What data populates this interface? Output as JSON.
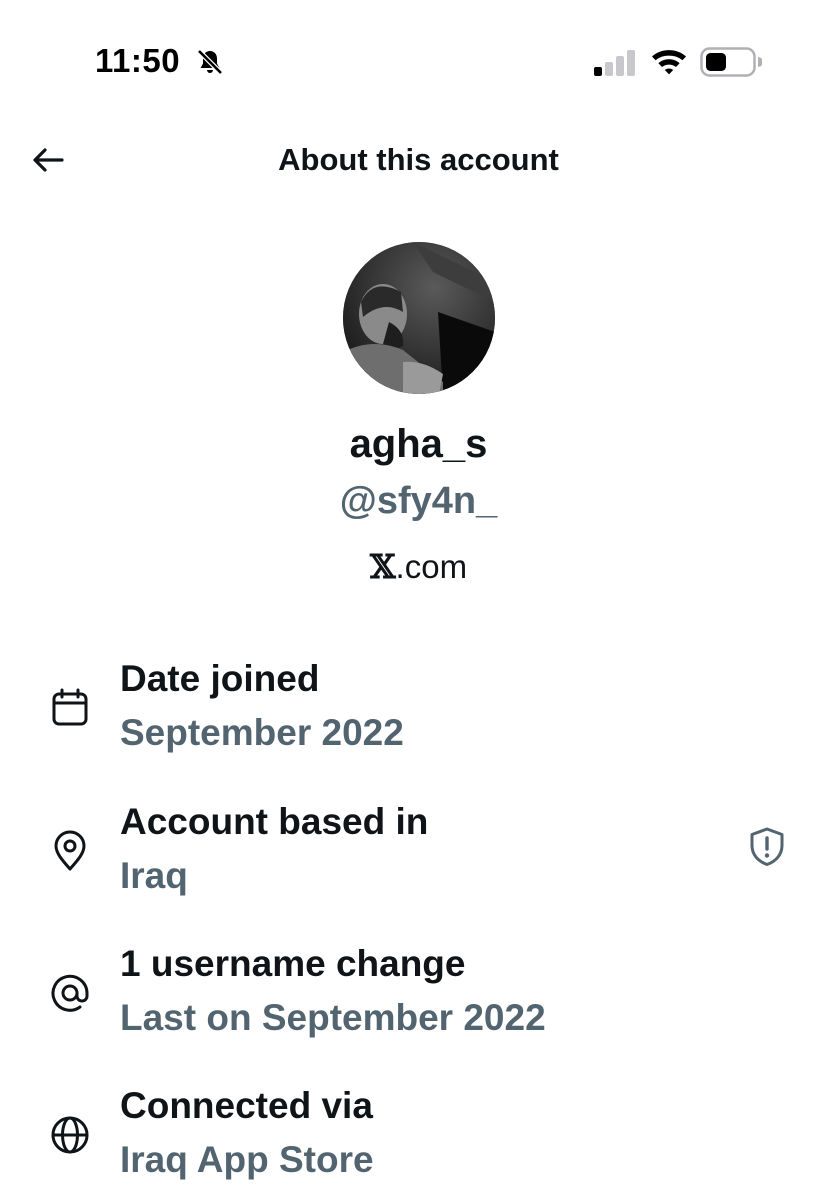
{
  "status_bar": {
    "time": "11:50",
    "icons": [
      "bell-slash-icon",
      "signal-icon",
      "wifi-icon",
      "battery-icon"
    ]
  },
  "header": {
    "title": "About this account",
    "back_icon": "arrow-left-icon"
  },
  "profile": {
    "display_name": "agha_s",
    "handle": "@sfy4n_",
    "platform_prefix": "𝕏",
    "platform_suffix": ".com"
  },
  "info": [
    {
      "icon": "calendar-icon",
      "label": "Date joined",
      "value": "September 2022"
    },
    {
      "icon": "location-pin-icon",
      "label": "Account based in",
      "value": "Iraq",
      "extra_icon": "shield-alert-icon"
    },
    {
      "icon": "at-sign-icon",
      "label": "1 username change",
      "value": "Last on September 2022"
    },
    {
      "icon": "globe-icon",
      "label": "Connected via",
      "value": "Iraq App Store"
    }
  ],
  "colors": {
    "primary_text": "#0f1419",
    "secondary_text": "#536471",
    "background": "#ffffff"
  }
}
